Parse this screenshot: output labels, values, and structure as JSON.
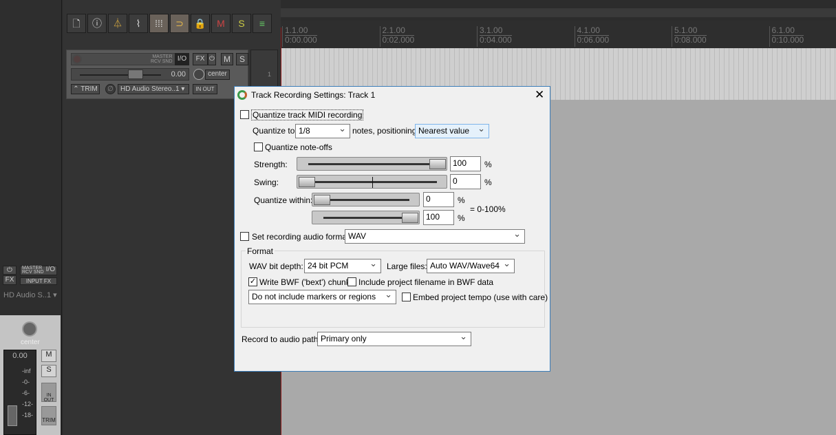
{
  "toolbar": {
    "icons": [
      "new-project-icon",
      "project-info-icon",
      "metronome-icon",
      "envelope-icon",
      "grid-icon",
      "snap-icon",
      "lock-icon",
      "mute-clear-icon",
      "solo-clear-icon",
      "mixer-icon"
    ]
  },
  "master_track": {
    "master_label": "MASTER",
    "rcv_label": "RCV SND",
    "io_label": "I/O",
    "fx_label": "FX",
    "m_label": "M",
    "s_label": "S",
    "volume": "0.00",
    "pan": "center",
    "trim_label": "TRIM",
    "input_device": "HD Audio Stereo..1",
    "inout_label": "IN OUT",
    "track_number": "1"
  },
  "mixer": {
    "master_label": "MASTER",
    "rcv_label": "RCV SND",
    "io_label": "I/O",
    "fx_label": "FX",
    "input_fx_label": "INPUT FX",
    "input_device": "HD Audio S..1",
    "pan": "center",
    "volume": "0.00",
    "m_label": "M",
    "s_label": "S",
    "inout_label": "IN OUT",
    "trim_label": "TRIM",
    "meter_ticks": [
      "-inf",
      "-0-",
      "-6-",
      "-12-",
      "-18-"
    ]
  },
  "ruler": [
    {
      "bar": "1.1.00",
      "time": "0:00.000"
    },
    {
      "bar": "2.1.00",
      "time": "0:02.000"
    },
    {
      "bar": "3.1.00",
      "time": "0:04.000"
    },
    {
      "bar": "4.1.00",
      "time": "0:06.000"
    },
    {
      "bar": "5.1.00",
      "time": "0:08.000"
    },
    {
      "bar": "6.1.00",
      "time": "0:10.000"
    }
  ],
  "dialog": {
    "title": "Track Recording Settings: Track 1",
    "quantize_midi": {
      "label": "Quantize track MIDI recording",
      "checked": false
    },
    "quantize_to_label": "Quantize to:",
    "quantize_to_value": "1/8",
    "positioning_label": "notes, positioning:",
    "positioning_value": "Nearest value",
    "note_offs": {
      "label": "Quantize note-offs",
      "checked": false
    },
    "strength_label": "Strength:",
    "strength_value": "100",
    "strength_pct": 100,
    "swing_label": "Swing:",
    "swing_value": "0",
    "swing_pct": 0,
    "within_label": "Quantize within:",
    "within_min": "0",
    "within_max": "100",
    "within_range": "= 0-100%",
    "pct": "%",
    "audio_format": {
      "label": "Set recording audio format:",
      "checked": false,
      "value": "WAV"
    },
    "format_group": "Format",
    "bit_depth_label": "WAV bit depth:",
    "bit_depth_value": "24 bit PCM",
    "large_files_label": "Large files:",
    "large_files_value": "Auto WAV/Wave64",
    "bwf": {
      "label": "Write BWF ('bext') chunk",
      "checked": true
    },
    "include_filename": {
      "label": "Include project filename in BWF data",
      "checked": false
    },
    "markers_value": "Do not include markers or regions",
    "embed_tempo": {
      "label": "Embed project tempo (use with care)",
      "checked": false
    },
    "path_label": "Record to audio path:",
    "path_value": "Primary only"
  }
}
